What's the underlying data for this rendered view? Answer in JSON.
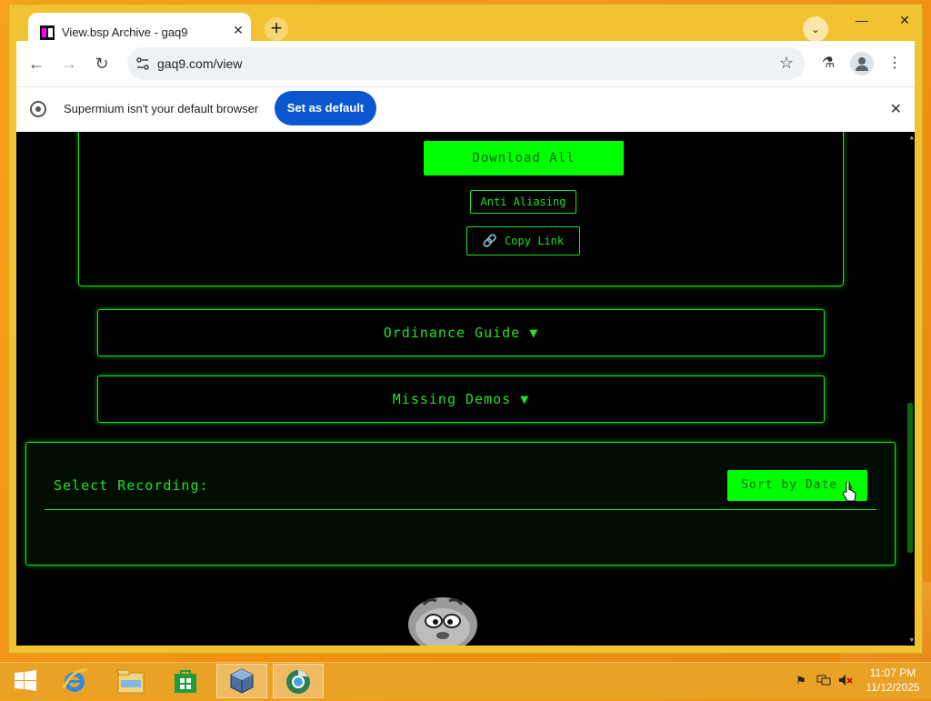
{
  "browser": {
    "tab_title": "View.bsp Archive - gaq9",
    "tab_close": "✕",
    "new_tab": "+",
    "url": "gaq9.com/view",
    "window_controls": {
      "minimize": "—",
      "maximize": "☐",
      "close": "✕"
    }
  },
  "infobar": {
    "message": "Supermium isn't your default browser",
    "button_label": "Set as default",
    "close": "✕"
  },
  "page": {
    "download_all_label": "Download All",
    "anti_aliasing_label": "Anti Aliasing",
    "copy_link_label": "Copy Link",
    "ordinance_guide_label": "Ordinance Guide ▼",
    "missing_demos_label": "Missing Demos ▼",
    "select_recording_label": "Select Recording:",
    "sort_label": "Sort by Date ▲"
  },
  "taskbar": {
    "time": "11:07 PM",
    "date": "11/12/2025"
  },
  "icons": [
    "start-icon",
    "ie-icon",
    "file-explorer-icon",
    "store-icon",
    "virtualbox-icon",
    "browser-icon",
    "flag-icon",
    "network-icon",
    "volume-muted-icon",
    "link-icon",
    "mascot-icon"
  ],
  "colors": {
    "accent_green": "#00ff00",
    "border_green": "#1ee31e",
    "infobar_button": "#0b57d0",
    "chrome_frame": "#f1c232"
  }
}
